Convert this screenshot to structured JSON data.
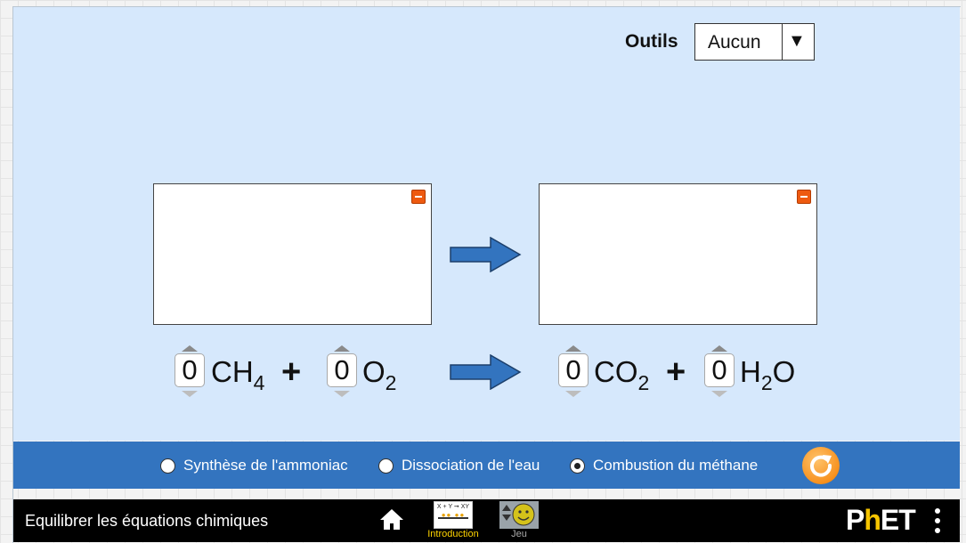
{
  "tools": {
    "label": "Outils",
    "selected": "Aucun"
  },
  "equation": {
    "reactants": [
      {
        "coefficient": "0",
        "formula": "CH",
        "subscript": "4",
        "suffix": ""
      },
      {
        "coefficient": "0",
        "formula": "O",
        "subscript": "2",
        "suffix": ""
      }
    ],
    "products": [
      {
        "coefficient": "0",
        "formula": "CO",
        "subscript": "2",
        "suffix": ""
      },
      {
        "coefficient": "0",
        "formula": "H",
        "subscript": "2",
        "suffix": "O"
      }
    ],
    "plus": "+"
  },
  "reactions": [
    {
      "label": "Synthèse de l'ammoniac",
      "selected": false
    },
    {
      "label": "Dissociation de l'eau",
      "selected": false
    },
    {
      "label": "Combustion du méthane",
      "selected": true
    }
  ],
  "nav": {
    "title": "Equilibrer les équations chimiques",
    "screens": [
      {
        "label": "Introduction",
        "active": true,
        "icon_text": "X + Y ➞ XY"
      },
      {
        "label": "Jeu",
        "active": false
      }
    ],
    "logo": {
      "p": "P",
      "h": "h",
      "et": "ET"
    }
  },
  "colors": {
    "play_area": "#d6e8fc",
    "control_panel": "#3374bf",
    "arrow": "#3374bf",
    "minimize": "#ee5a10",
    "reset": "#f7911e",
    "active_screen": "#ffd400"
  }
}
